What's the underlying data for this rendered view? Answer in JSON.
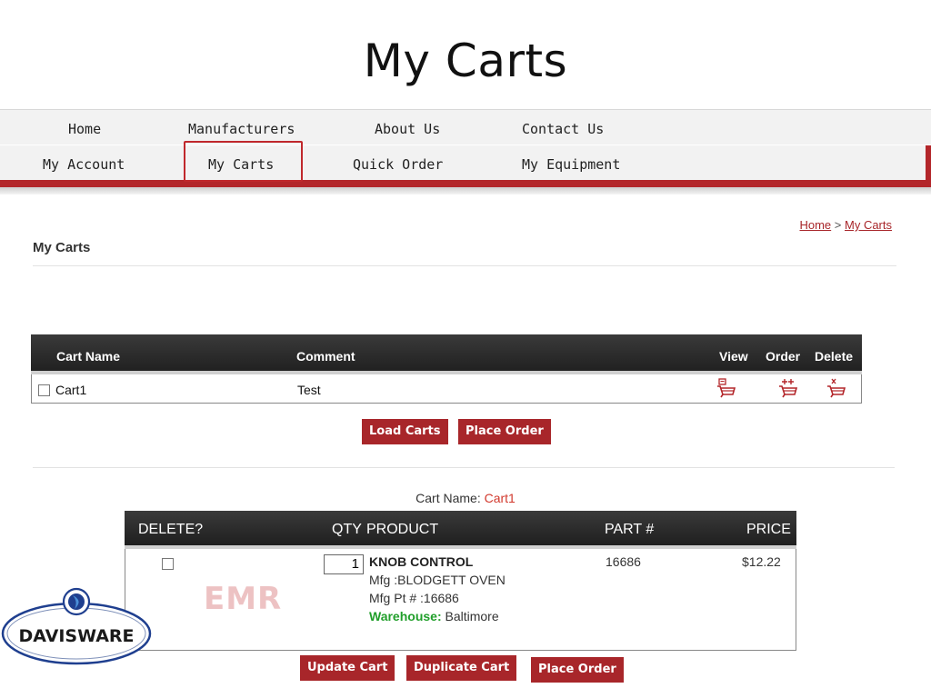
{
  "slide_title": "My Carts",
  "nav": {
    "row1": [
      "Home",
      "Manufacturers",
      "About Us",
      "Contact Us"
    ],
    "row2": [
      "My Account",
      "My Carts",
      "Quick Order",
      "My Equipment"
    ]
  },
  "breadcrumb": {
    "home": "Home",
    "separator": " > ",
    "current": "My Carts"
  },
  "page_heading": "My Carts",
  "carts_table": {
    "headers": {
      "name": "Cart Name",
      "comment": "Comment",
      "view": "View",
      "order": "Order",
      "delete": "Delete"
    },
    "rows": [
      {
        "name": "Cart1",
        "comment": "Test"
      }
    ]
  },
  "cart_buttons": {
    "load": "Load Carts",
    "place_order": "Place Order"
  },
  "cart_name": {
    "label": "Cart Name:",
    "value": "Cart1"
  },
  "items_table": {
    "headers": {
      "delete": "DELETE?",
      "qty": "QTY",
      "product": "PRODUCT",
      "part": "PART #",
      "price": "PRICE"
    },
    "rows": [
      {
        "qty": "1",
        "product": "KNOB CONTROL",
        "mfg": "Mfg :BLODGETT OVEN",
        "mfg_pt": "Mfg Pt # :16686",
        "warehouse_label": "Warehouse:",
        "warehouse": " Baltimore",
        "part": "16686",
        "price": "$12.22"
      }
    ]
  },
  "item_buttons": {
    "update": "Update Cart",
    "duplicate": "Duplicate Cart",
    "place_order": "Place Order"
  },
  "watermark_logo": "EMR",
  "logo_text": "DAVISWARE",
  "colors": {
    "brand_red": "#a8262a",
    "highlight_box": "#c0282c",
    "cart_name_value": "#d2382c",
    "warehouse": "#219f2b"
  }
}
